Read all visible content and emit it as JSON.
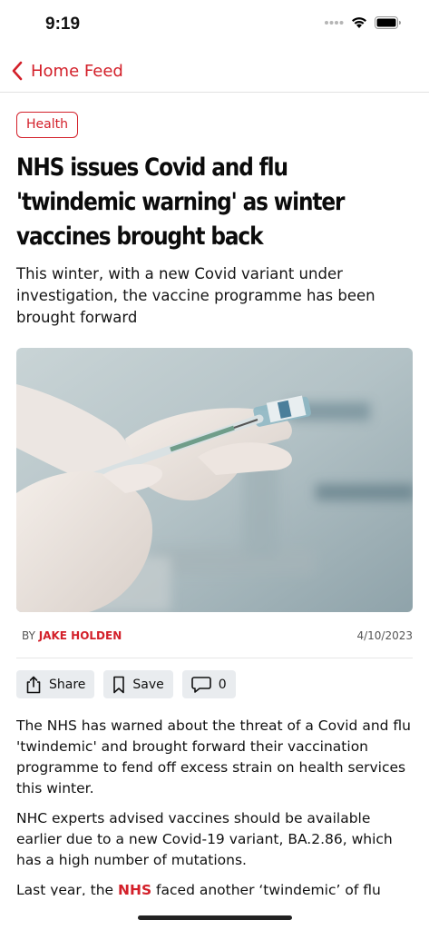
{
  "status": {
    "time": "9:19",
    "icons": [
      "cellular-dots-icon",
      "wifi-icon",
      "battery-icon"
    ]
  },
  "nav": {
    "back_label": "Home Feed",
    "back_icon": "chevron-left-icon"
  },
  "article": {
    "category": "Health",
    "headline_line1": "NHS issues Covid and flu",
    "headline_line2": "'twindemic warning' as winter",
    "headline_line3": "vaccines brought back",
    "standfirst": "This winter, with a new Covid variant under investigation, the vaccine programme has been brought forward",
    "image": "gloved-hands-syringe-vaccine-vial-photo",
    "by_prefix": "BY ",
    "author": "JAKE HOLDEN",
    "date": "4/10/2023",
    "body": {
      "p1": "The NHS has warned about the threat of a Covid and flu 'twindemic' and brought forward their vaccination programme to fend off excess strain on health services this winter.",
      "p2": "NHC experts advised vaccines should be available earlier due to a new Covid-19 variant, BA.2.86, which has a high number of mutations.",
      "p3_before": "Last year, the ",
      "p3_link": "NHS",
      "p3_after": " faced another ‘twindemic’ of flu"
    }
  },
  "actions": {
    "share_label": "Share",
    "save_label": "Save",
    "comments_count": "0"
  },
  "colors": {
    "accent": "#d3202a",
    "action_bg": "#e9ecef"
  }
}
